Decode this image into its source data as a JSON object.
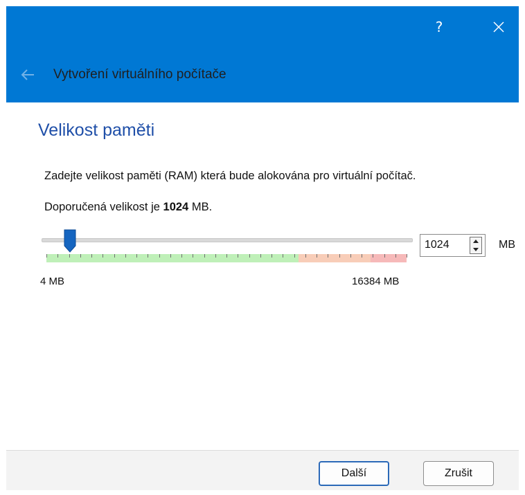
{
  "window": {
    "title": "Vytvoření virtuálního počítače",
    "help_label": "?",
    "accent_color": "#0078d4"
  },
  "page": {
    "heading": "Velikost paměti",
    "description": "Zadejte velikost paměti (RAM) která bude alokována pro virtuální počítač.",
    "recommended_prefix": "Doporučená velikost je",
    "recommended_value": "1024",
    "recommended_suffix": "MB."
  },
  "memory": {
    "value": "1024",
    "unit": "MB",
    "min_label": "4 MB",
    "max_label": "16384 MB",
    "slider_min": 4,
    "slider_max": 16384,
    "slider_value": 1024,
    "zone_colors": {
      "safe": "#bff0b8",
      "warning": "#f8cdb8",
      "danger": "#f6b9b9"
    }
  },
  "footer": {
    "next_label": "Další",
    "cancel_label": "Zrušit"
  },
  "icons": {
    "back": "arrow-left-icon",
    "close": "close-icon",
    "spin_up": "triangle-up-icon",
    "spin_down": "triangle-down-icon"
  }
}
